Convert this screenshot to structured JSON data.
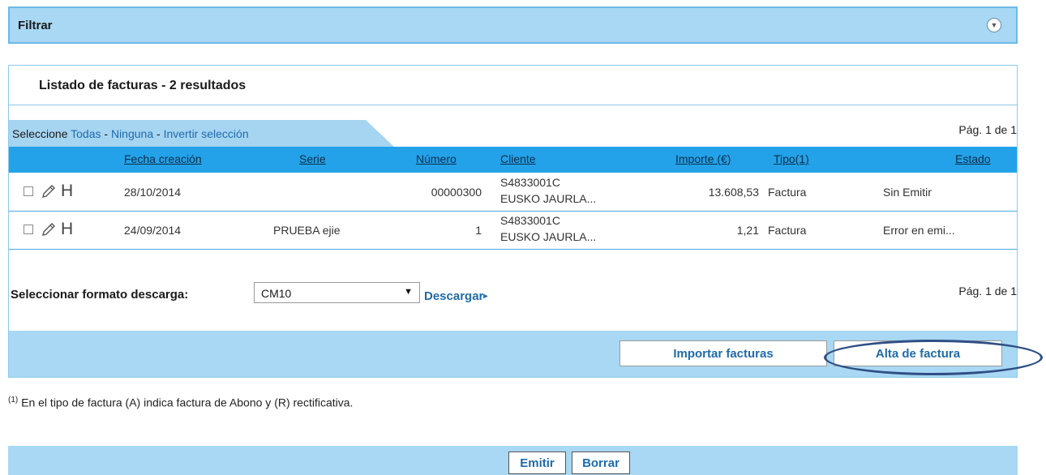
{
  "filter": {
    "title": "Filtrar",
    "toggle_icon": "chevron-down-circle-icon"
  },
  "results": {
    "title": "Listado de facturas - 2 resultados",
    "select_prefix": "Seleccione ",
    "select_all": "Todas",
    "select_none": "Ninguna",
    "select_invert": "Invertir selección",
    "separator": " - ",
    "page_top": "Pág. 1 de 1",
    "page_bottom": "Pág. 1 de 1",
    "columns": {
      "fecha": "Fecha creación",
      "serie": "Serie",
      "numero": "Número",
      "cliente": "Cliente",
      "importe": "Importe (€)",
      "tipo": "Tipo(1)",
      "estado": "Estado"
    },
    "rows": [
      {
        "fecha": "28/10/2014",
        "serie": "",
        "numero": "00000300",
        "cliente_nif": "S4833001C",
        "cliente_nombre": "EUSKO JAURLA...",
        "importe": "13.608,53",
        "tipo": "Factura",
        "estado": "Sin Emitir",
        "h_label": "H"
      },
      {
        "fecha": "24/09/2014",
        "serie": "PRUEBA ejie",
        "numero": "1",
        "cliente_nif": "S4833001C",
        "cliente_nombre": "EUSKO JAURLA...",
        "importe": "1,21",
        "tipo": "Factura",
        "estado": "Error en emi...",
        "h_label": "H"
      }
    ]
  },
  "download": {
    "label": "Seleccionar formato descarga:",
    "format_value": "CM10",
    "link_label": "Descargar",
    "link_arrow": "▸"
  },
  "actions": {
    "import_label": "Importar facturas",
    "new_label": "Alta de factura"
  },
  "footnote": {
    "marker": "(1)",
    "text": " En el tipo de factura (A) indica factura de Abono y (R) rectificativa."
  },
  "bottom": {
    "emit_label": "Emitir",
    "delete_label": "Borrar"
  },
  "colors": {
    "header_blue": "#23a2e9",
    "light_blue": "#a8d8f3",
    "link_blue": "#1f6bab",
    "highlight": "#2f4f85"
  }
}
